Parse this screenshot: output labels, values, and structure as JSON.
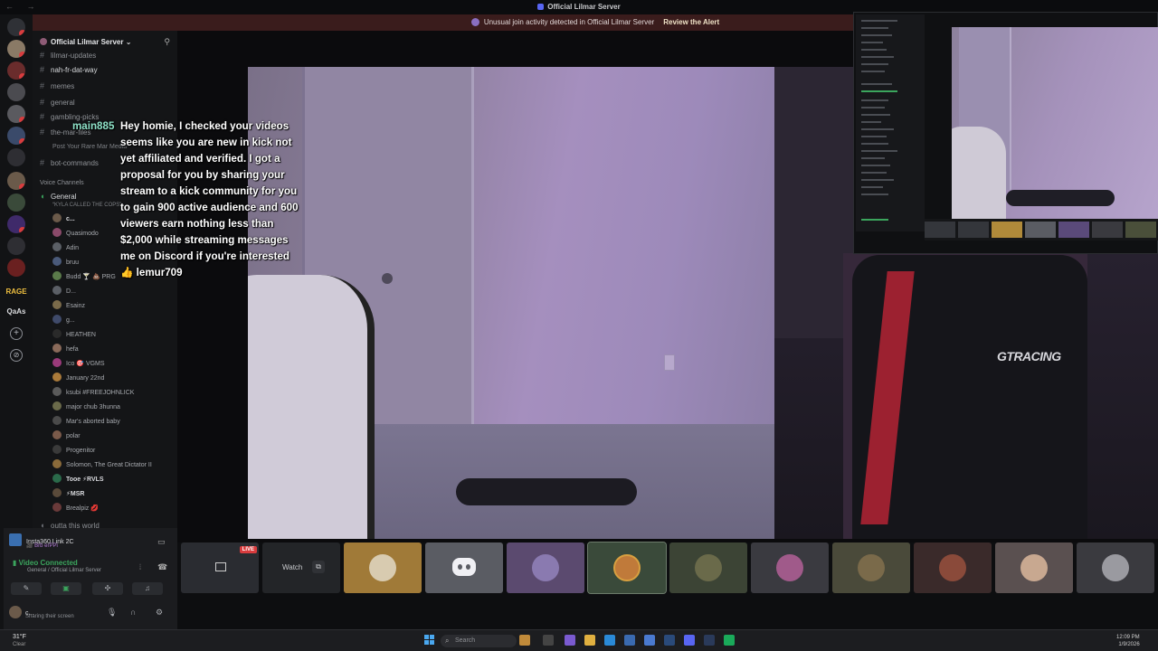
{
  "window": {
    "title": "Official Lilmar Server",
    "alert_text": "Unusual join activity detected in Official Lilmar Server",
    "alert_action": "Review the Alert"
  },
  "rail": {
    "label_rage": "RAGE",
    "label_qas": "QaAs",
    "add_icon": "+",
    "explore_icon": "⊘"
  },
  "sidebar": {
    "server_name": "Official Lilmar Server",
    "channels": [
      {
        "name": "lilmar-updates"
      },
      {
        "name": "nah-fr-dat-way"
      },
      {
        "name": "memes"
      },
      {
        "name": "general"
      },
      {
        "name": "gambling-picks"
      },
      {
        "name": "the-mar-files"
      },
      {
        "name": "bot-commands"
      }
    ],
    "thread": "Post Your Rare Mar Media",
    "voice_category": "Voice Channels",
    "voice_channel": "General",
    "voice_channel_status": "“KYLA CALLED THE COPS”",
    "voice_users": [
      {
        "name": "c...",
        "bold": true
      },
      {
        "name": "Quasimodo"
      },
      {
        "name": "Adin"
      },
      {
        "name": "bruu"
      },
      {
        "name": "Budd 🍸 💩 PRG"
      },
      {
        "name": "D..."
      },
      {
        "name": "Esainz"
      },
      {
        "name": "g..."
      },
      {
        "name": "HEATHEN"
      },
      {
        "name": "hefa"
      },
      {
        "name": "Ico 🎯 VGMS"
      },
      {
        "name": "January 22nd"
      },
      {
        "name": "ksubi #FREEJOHNLICK"
      },
      {
        "name": "major chub 3hunna"
      },
      {
        "name": "Mar's aborted baby"
      },
      {
        "name": "polar"
      },
      {
        "name": "Progenitor"
      },
      {
        "name": "Solomon, The Great Dictator II"
      },
      {
        "name": "Tooe ⚡RVLS",
        "bold": true
      },
      {
        "name": "⚡MSR",
        "bold": true
      },
      {
        "name": "Brealpiz 💋"
      }
    ],
    "next_category": "outta this world"
  },
  "voice_panel": {
    "device_name": "Insta360 Link 2C",
    "device_tag": "🎥 Brb erPPi",
    "connection_status": "Video Connected",
    "connection_channel": "General / Official Lilmar Server",
    "user_name": "c...",
    "user_status": "Sharing their screen"
  },
  "chat_overlay": {
    "username": "main885",
    "message": "Hey homie, I checked your videos seems like you are new in kick not yet affiliated and verified. I got a proposal for you by sharing your stream to a kick community for you to gain 900 active audience and 600 viewers earn nothing less than $2,000 while streaming messages me on Discord if you're interested 👍 lemur709"
  },
  "stream": {
    "chair_brand": "GTRACING"
  },
  "strip": {
    "live_badge": "LIVE",
    "watch_label": "Watch"
  },
  "taskbar": {
    "weather_temp": "31°F",
    "weather_cond": "Clear",
    "search_placeholder": "Search",
    "time": "12:09 PM",
    "date": "1/9/2026"
  },
  "colors": {
    "accent_green": "#3ba55d",
    "alert_bg": "#3a1c1c",
    "live_red": "#d83c3e",
    "username_teal": "#8fe3c9"
  }
}
